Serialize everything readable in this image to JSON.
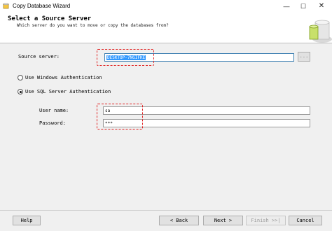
{
  "window": {
    "title": "Copy Database Wizard",
    "minimize": "—",
    "maximize": "☐",
    "close": "✕"
  },
  "header": {
    "title": "Select a Source Server",
    "subtitle": "Which server do you want to move or copy the databases from?"
  },
  "form": {
    "source_server_label": "Source server:",
    "source_server_value": "DESKTOP-7NGIFKE",
    "browse_label": "...",
    "windows_auth_label": "Use Windows Authentication",
    "sql_auth_label": "Use SQL Server Authentication",
    "auth_selected": "sql",
    "username_label": "User name:",
    "username_value": "sa",
    "password_label": "Password:",
    "password_value": "***"
  },
  "footer": {
    "help": "Help",
    "back": "< Back",
    "next": "Next >",
    "finish": "Finish >>|",
    "cancel": "Cancel"
  },
  "colors": {
    "highlight": "#e02020",
    "selection": "#3399ff"
  }
}
